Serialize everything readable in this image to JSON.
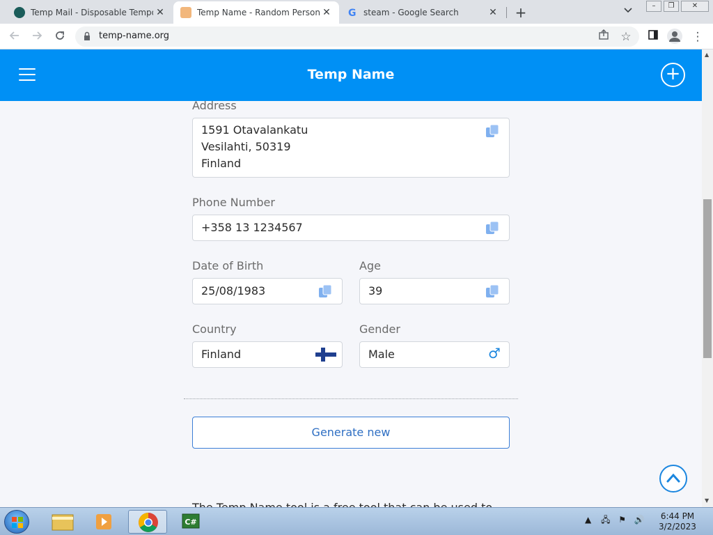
{
  "browser": {
    "tabs": [
      {
        "title": "Temp Mail - Disposable Temporary",
        "active": false
      },
      {
        "title": "Temp Name - Random Person Generator",
        "active": true
      },
      {
        "title": "steam - Google Search",
        "active": false
      }
    ],
    "new_tab": "+",
    "tab_close": "✕",
    "url": "temp-name.org"
  },
  "site": {
    "brand": "Temp Name",
    "plus_icon": "+",
    "colors": {
      "header": "#0090f5",
      "button_border": "#3b7ed6",
      "copy_icon": "#7fb0ef"
    }
  },
  "form": {
    "address_label": "Address",
    "address_lines": [
      "1591 Otavalankatu",
      "Vesilahti, 50319",
      "Finland"
    ],
    "phone_label": "Phone Number",
    "phone_value": "+358 13 1234567",
    "dob_label": "Date of Birth",
    "dob_value": "25/08/1983",
    "age_label": "Age",
    "age_value": "39",
    "country_label": "Country",
    "country_value": "Finland",
    "gender_label": "Gender",
    "gender_value": "Male",
    "gender_symbol": "♂",
    "generate_label": "Generate new"
  },
  "footer": {
    "text": "The Temp Name tool is a free tool that can be used to"
  },
  "taskbar": {
    "time": "6:44 PM",
    "date": "3/2/2023",
    "csharp_label": "C#"
  }
}
